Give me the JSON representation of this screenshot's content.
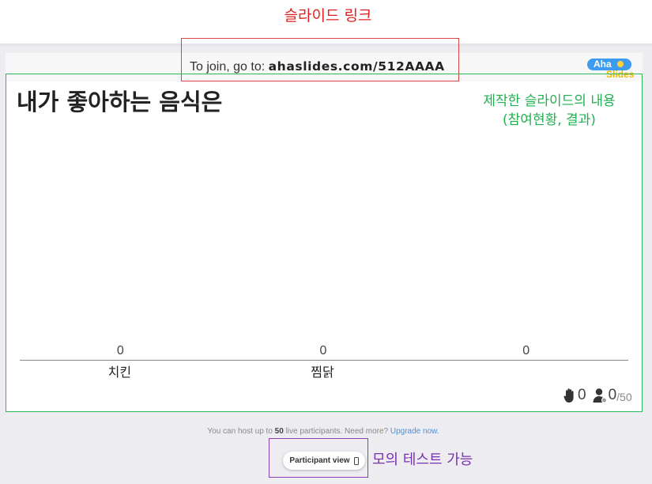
{
  "annotations": {
    "slide_link_label": "슬라이드 링크",
    "slide_content_label_line1": "제작한 슬라이드의 내용",
    "slide_content_label_line2": "(참여현황, 결과)",
    "mock_test_label": "모의 테스트 가능",
    "colors": {
      "red": "#e02020",
      "green": "#20b050",
      "purple": "#7a30b0"
    }
  },
  "header": {
    "join_prefix": "To join, go to: ",
    "join_url": "ahaslides.com/512AAAA",
    "logo_top": "Aha",
    "logo_bottom": "Slides"
  },
  "slide": {
    "title": "내가 좋아하는 음식은",
    "reactions_count": "0",
    "participants_count": "0",
    "participants_max": "/50"
  },
  "chart_data": {
    "type": "bar",
    "categories": [
      "치킨",
      "찜닭",
      ""
    ],
    "values": [
      0,
      0,
      0
    ],
    "title": "내가 좋아하는 음식은"
  },
  "footer": {
    "note_prefix": "You can host up to ",
    "note_bold": "50",
    "note_middle": " live participants. Need more? ",
    "note_link": "Upgrade now.",
    "participant_view_label": "Participant view"
  },
  "icons": {
    "reactions": "hand-icon",
    "participants": "user-icon",
    "device": "phone-icon"
  }
}
